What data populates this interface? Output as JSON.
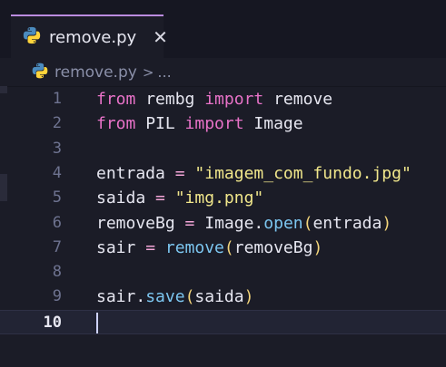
{
  "tab": {
    "filename": "remove.py",
    "close_glyph": "✕"
  },
  "breadcrumb": {
    "file": "remove.py",
    "separator": ">",
    "more": "..."
  },
  "code": {
    "lines": [
      {
        "num": "1",
        "tokens": [
          {
            "t": "from",
            "c": "kw"
          },
          {
            "t": " rembg ",
            "c": "id"
          },
          {
            "t": "import",
            "c": "kw"
          },
          {
            "t": " remove",
            "c": "id"
          }
        ]
      },
      {
        "num": "2",
        "tokens": [
          {
            "t": "from",
            "c": "kw"
          },
          {
            "t": " PIL ",
            "c": "id"
          },
          {
            "t": "import",
            "c": "kw"
          },
          {
            "t": " Image",
            "c": "id"
          }
        ]
      },
      {
        "num": "3",
        "tokens": []
      },
      {
        "num": "4",
        "tokens": [
          {
            "t": "entrada ",
            "c": "id"
          },
          {
            "t": "=",
            "c": "op"
          },
          {
            "t": " ",
            "c": "id"
          },
          {
            "t": "\"imagem_com_fundo.jpg\"",
            "c": "str"
          }
        ]
      },
      {
        "num": "5",
        "tokens": [
          {
            "t": "saida ",
            "c": "id"
          },
          {
            "t": "=",
            "c": "op"
          },
          {
            "t": " ",
            "c": "id"
          },
          {
            "t": "\"img.png\"",
            "c": "str"
          }
        ]
      },
      {
        "num": "6",
        "tokens": [
          {
            "t": "removeBg ",
            "c": "id"
          },
          {
            "t": "=",
            "c": "op"
          },
          {
            "t": " Image",
            "c": "id"
          },
          {
            "t": ".",
            "c": "dot"
          },
          {
            "t": "open",
            "c": "fn"
          },
          {
            "t": "(",
            "c": "par"
          },
          {
            "t": "entrada",
            "c": "id"
          },
          {
            "t": ")",
            "c": "par"
          }
        ]
      },
      {
        "num": "7",
        "tokens": [
          {
            "t": "sair ",
            "c": "id"
          },
          {
            "t": "=",
            "c": "op"
          },
          {
            "t": " ",
            "c": "id"
          },
          {
            "t": "remove",
            "c": "fn"
          },
          {
            "t": "(",
            "c": "par"
          },
          {
            "t": "removeBg",
            "c": "id"
          },
          {
            "t": ")",
            "c": "par"
          }
        ]
      },
      {
        "num": "8",
        "tokens": []
      },
      {
        "num": "9",
        "tokens": [
          {
            "t": "sair",
            "c": "id"
          },
          {
            "t": ".",
            "c": "dot"
          },
          {
            "t": "save",
            "c": "fn"
          },
          {
            "t": "(",
            "c": "par"
          },
          {
            "t": "saida",
            "c": "id"
          },
          {
            "t": ")",
            "c": "par"
          }
        ]
      },
      {
        "num": "10",
        "tokens": [],
        "active": true
      }
    ]
  },
  "colors": {
    "keyword": "#e872c8",
    "string": "#f1e78b",
    "function": "#7cc6f0",
    "paren": "#f2d47a",
    "tab_accent": "#bb8be0"
  },
  "icons": {
    "file_icon": "python-icon",
    "close_icon": "close-icon"
  }
}
